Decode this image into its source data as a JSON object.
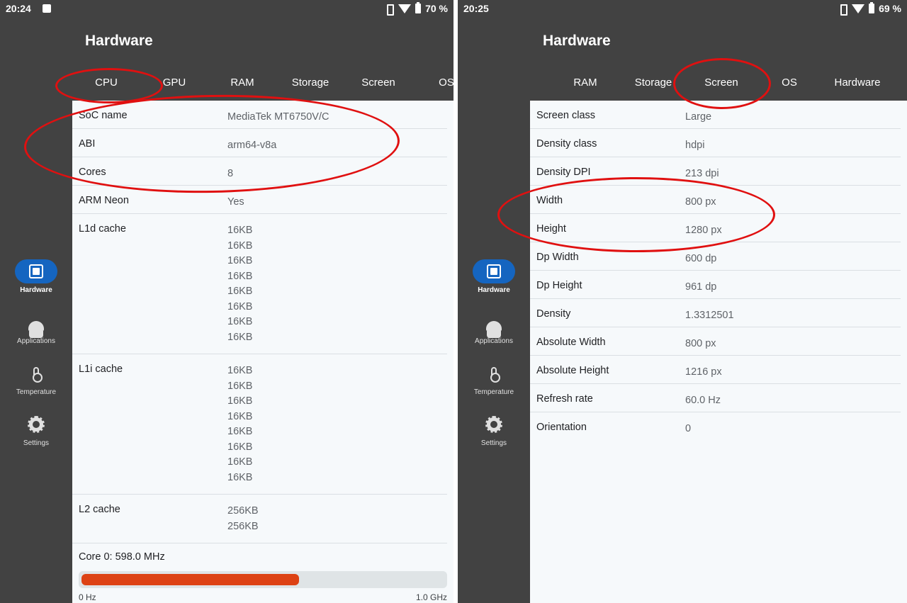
{
  "left": {
    "status": {
      "time": "20:24",
      "battery": "70 %"
    },
    "app_title": "Hardware",
    "tabs": [
      "CPU",
      "GPU",
      "RAM",
      "Storage",
      "Screen",
      "OS"
    ],
    "nav": [
      {
        "label": "Hardware",
        "icon": "chip-icon"
      },
      {
        "label": "Applications",
        "icon": "android-icon"
      },
      {
        "label": "Temperature",
        "icon": "thermometer-icon"
      },
      {
        "label": "Settings",
        "icon": "gear-icon"
      }
    ],
    "rows": [
      {
        "label": "SoC name",
        "values": [
          "MediaTek MT6750V/C"
        ]
      },
      {
        "label": "ABI",
        "values": [
          "arm64-v8a"
        ]
      },
      {
        "label": "Cores",
        "values": [
          "8"
        ]
      },
      {
        "label": "ARM Neon",
        "values": [
          "Yes"
        ]
      },
      {
        "label": "L1d cache",
        "values": [
          "16KB",
          "16KB",
          "16KB",
          "16KB",
          "16KB",
          "16KB",
          "16KB",
          "16KB"
        ]
      },
      {
        "label": "L1i cache",
        "values": [
          "16KB",
          "16KB",
          "16KB",
          "16KB",
          "16KB",
          "16KB",
          "16KB",
          "16KB"
        ]
      },
      {
        "label": "L2 cache",
        "values": [
          "256KB",
          "256KB"
        ]
      }
    ],
    "core": {
      "label": "Core 0: 598.0 MHz",
      "min": "0 Hz",
      "max": "1.0 GHz",
      "fraction": 0.6
    }
  },
  "right": {
    "status": {
      "time": "20:25",
      "battery": "69 %"
    },
    "app_title": "Hardware",
    "tabs": [
      "RAM",
      "Storage",
      "Screen",
      "OS",
      "Hardware"
    ],
    "nav": [
      {
        "label": "Hardware",
        "icon": "chip-icon"
      },
      {
        "label": "Applications",
        "icon": "android-icon"
      },
      {
        "label": "Temperature",
        "icon": "thermometer-icon"
      },
      {
        "label": "Settings",
        "icon": "gear-icon"
      }
    ],
    "rows": [
      {
        "label": "Screen class",
        "values": [
          "Large"
        ]
      },
      {
        "label": "Density class",
        "values": [
          "hdpi"
        ]
      },
      {
        "label": "Density DPI",
        "values": [
          "213 dpi"
        ]
      },
      {
        "label": "Width",
        "values": [
          "800 px"
        ]
      },
      {
        "label": "Height",
        "values": [
          "1280 px"
        ]
      },
      {
        "label": "Dp Width",
        "values": [
          "600 dp"
        ]
      },
      {
        "label": "Dp Height",
        "values": [
          "961 dp"
        ]
      },
      {
        "label": "Density",
        "values": [
          "1.3312501"
        ]
      },
      {
        "label": "Absolute Width",
        "values": [
          "800 px"
        ]
      },
      {
        "label": "Absolute Height",
        "values": [
          "1216 px"
        ]
      },
      {
        "label": "Refresh rate",
        "values": [
          "60.0 Hz"
        ]
      },
      {
        "label": "Orientation",
        "values": [
          "0"
        ]
      }
    ]
  },
  "colors": {
    "background": "#424242",
    "content": "#f6f9fb",
    "accent": "#1565c0",
    "progress": "#dd4214",
    "annotation": "#e01010"
  }
}
